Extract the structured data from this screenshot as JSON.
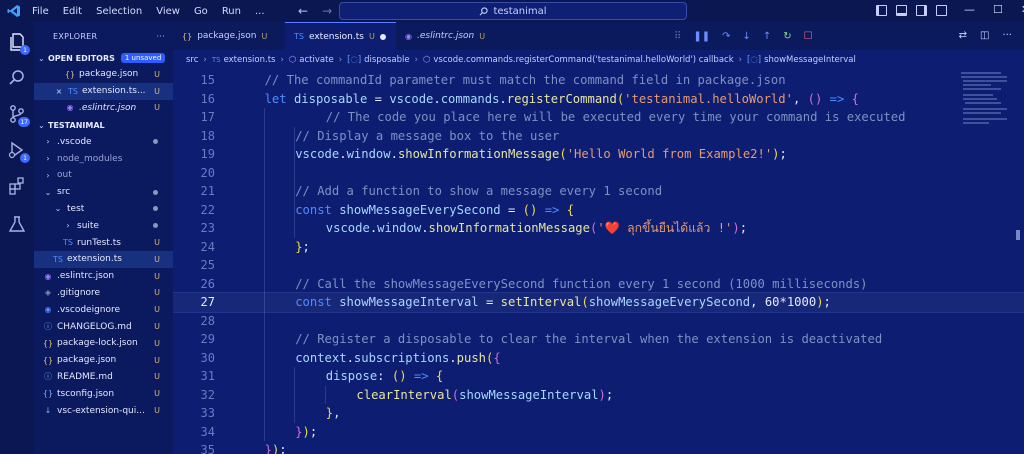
{
  "menu": [
    "File",
    "Edit",
    "Selection",
    "View",
    "Go",
    "Run"
  ],
  "more_menu": "...",
  "search": {
    "text": "testanimal"
  },
  "window_controls": {
    "minimize": "—",
    "maximize": "☐",
    "close": "✕"
  },
  "activity": {
    "explorer_badge": "1",
    "scm_badge": "17",
    "debug_badge": "1"
  },
  "sidebar": {
    "title": "EXPLORER",
    "more": "···",
    "open_editors": {
      "label": "OPEN EDITORS",
      "badge": "1 unsaved",
      "items": [
        {
          "name": "package.json",
          "status": "U",
          "icon": "{}",
          "icon_color": "#e5c07b"
        },
        {
          "name": "extension.ts...",
          "status": "U",
          "icon": "TS",
          "icon_color": "#4e8cff",
          "close": "×"
        },
        {
          "name": ".eslintrc.json",
          "status": "U",
          "icon": "◉",
          "icon_color": "#9d7cff"
        }
      ]
    },
    "project": {
      "label": "TESTANIMAL",
      "items": [
        {
          "name": ".vscode",
          "status": "",
          "icon": "›",
          "icon_color": "#c8ceff",
          "depth": 1,
          "dot": true
        },
        {
          "name": "node_modules",
          "status": "",
          "icon": "›",
          "icon_color": "#c8ceff",
          "depth": 1,
          "dot": false,
          "dim": true
        },
        {
          "name": "out",
          "status": "",
          "icon": "›",
          "icon_color": "#c8ceff",
          "depth": 1,
          "dot": false,
          "dim": true
        },
        {
          "name": "src",
          "status": "",
          "icon": "⌄",
          "icon_color": "#c8ceff",
          "depth": 1,
          "dot": true
        },
        {
          "name": "test",
          "status": "",
          "icon": "⌄",
          "icon_color": "#c8ceff",
          "depth": 2,
          "dot": true
        },
        {
          "name": "suite",
          "status": "",
          "icon": "›",
          "icon_color": "#c8ceff",
          "depth": 3,
          "dot": true
        },
        {
          "name": "runTest.ts",
          "status": "U",
          "icon": "TS",
          "icon_color": "#4e8cff",
          "depth": 3
        },
        {
          "name": "extension.ts",
          "status": "U",
          "icon": "TS",
          "icon_color": "#4e8cff",
          "depth": 2,
          "selected": true
        },
        {
          "name": ".eslintrc.json",
          "status": "U",
          "icon": "◉",
          "icon_color": "#9d7cff",
          "depth": 1
        },
        {
          "name": ".gitignore",
          "status": "U",
          "icon": "◈",
          "icon_color": "#8c96b8",
          "depth": 1
        },
        {
          "name": ".vscodeignore",
          "status": "U",
          "icon": "◉",
          "icon_color": "#4e8cff",
          "depth": 1
        },
        {
          "name": "CHANGELOG.md",
          "status": "U",
          "icon": "ⓘ",
          "icon_color": "#7fb0ff",
          "depth": 1
        },
        {
          "name": "package-lock.json",
          "status": "U",
          "icon": "{}",
          "icon_color": "#e5c07b",
          "depth": 1
        },
        {
          "name": "package.json",
          "status": "U",
          "icon": "{}",
          "icon_color": "#e5c07b",
          "depth": 1
        },
        {
          "name": "README.md",
          "status": "U",
          "icon": "ⓘ",
          "icon_color": "#7fb0ff",
          "depth": 1
        },
        {
          "name": "tsconfig.json",
          "status": "U",
          "icon": "{}",
          "icon_color": "#7fb0ff",
          "depth": 1
        },
        {
          "name": "vsc-extension-qui...",
          "status": "U",
          "icon": "↓",
          "icon_color": "#7fb0ff",
          "depth": 1
        }
      ]
    }
  },
  "tabs": [
    {
      "name": "package.json",
      "status": "U",
      "icon": "{}",
      "icon_color": "#e5c07b"
    },
    {
      "name": "extension.ts",
      "status": "U",
      "icon": "TS",
      "icon_color": "#4e8cff",
      "active": true,
      "dirty": true
    },
    {
      "name": ".eslintrc.json",
      "status": "U",
      "icon": "◉",
      "icon_color": "#9d7cff",
      "italic": true
    }
  ],
  "breadcrumb": [
    "src",
    "extension.ts",
    "activate",
    "disposable",
    "vscode.commands.registerCommand('testanimal.helloWorld') callback",
    "showMessageInterval"
  ],
  "editor": {
    "current_line": 27,
    "lines": [
      {
        "n": "15",
        "i": 1,
        "t": [
          [
            "c-cm",
            "// The commandId parameter must match the command field in package.json"
          ]
        ]
      },
      {
        "n": "16",
        "i": 1,
        "t": [
          [
            "c-kw",
            "let "
          ],
          [
            "c-var",
            "disposable"
          ],
          [
            "c-pun",
            " = "
          ],
          [
            "c-var",
            "vscode"
          ],
          [
            "c-pun",
            "."
          ],
          [
            "c-var",
            "commands"
          ],
          [
            "c-pun",
            "."
          ],
          [
            "c-fn",
            "registerCommand"
          ],
          [
            "c-br",
            "("
          ],
          [
            "c-str",
            "'testanimal.helloWorld'"
          ],
          [
            "c-pun",
            ", "
          ],
          [
            "c-br2",
            "()"
          ],
          [
            "c-kw",
            " => "
          ],
          [
            "c-br2",
            "{"
          ]
        ]
      },
      {
        "n": "17",
        "i": 3,
        "t": [
          [
            "c-cm",
            "// The code you place here will be executed every time your command is executed"
          ]
        ]
      },
      {
        "n": "18",
        "i": 2,
        "t": [
          [
            "c-cm",
            "// Display a message box to the user"
          ]
        ]
      },
      {
        "n": "19",
        "i": 2,
        "t": [
          [
            "c-var",
            "vscode"
          ],
          [
            "c-pun",
            "."
          ],
          [
            "c-var",
            "window"
          ],
          [
            "c-pun",
            "."
          ],
          [
            "c-fn",
            "showInformationMessage"
          ],
          [
            "c-br",
            "("
          ],
          [
            "c-str",
            "'Hello World from Example2!'"
          ],
          [
            "c-br",
            ")"
          ],
          [
            "c-pun",
            ";"
          ]
        ]
      },
      {
        "n": "20",
        "i": 0,
        "t": []
      },
      {
        "n": "21",
        "i": 2,
        "t": [
          [
            "c-cm",
            "// Add a function to show a message every 1 second"
          ]
        ]
      },
      {
        "n": "22",
        "i": 2,
        "t": [
          [
            "c-kw",
            "const "
          ],
          [
            "c-var",
            "showMessageEverySecond"
          ],
          [
            "c-pun",
            " = "
          ],
          [
            "c-br",
            "()"
          ],
          [
            "c-kw",
            " => "
          ],
          [
            "c-br",
            "{"
          ]
        ]
      },
      {
        "n": "23",
        "i": 3,
        "t": [
          [
            "c-var",
            "vscode"
          ],
          [
            "c-pun",
            "."
          ],
          [
            "c-var",
            "window"
          ],
          [
            "c-pun",
            "."
          ],
          [
            "c-fn",
            "showInformationMessage"
          ],
          [
            "c-br2",
            "("
          ],
          [
            "c-str",
            "'❤️ ลุกขึ้นยืนได้แล้ว !'"
          ],
          [
            "c-br2",
            ")"
          ],
          [
            "c-pun",
            ";"
          ]
        ]
      },
      {
        "n": "24",
        "i": 2,
        "t": [
          [
            "c-br",
            "}"
          ],
          [
            "c-pun",
            ";"
          ]
        ]
      },
      {
        "n": "25",
        "i": 0,
        "t": []
      },
      {
        "n": "26",
        "i": 2,
        "t": [
          [
            "c-cm",
            "// Call the showMessageEverySecond function every 1 second (1000 milliseconds)"
          ]
        ]
      },
      {
        "n": "27",
        "i": 2,
        "t": [
          [
            "c-kw",
            "const "
          ],
          [
            "c-var",
            "showMessageInterval"
          ],
          [
            "c-pun",
            " = "
          ],
          [
            "c-fn",
            "setInterval"
          ],
          [
            "c-br",
            "("
          ],
          [
            "c-var",
            "showMessageEverySecond"
          ],
          [
            "c-pun",
            ", 60*1000"
          ],
          [
            "c-br",
            ")"
          ],
          [
            "c-pun",
            ";"
          ]
        ]
      },
      {
        "n": "28",
        "i": 0,
        "t": []
      },
      {
        "n": "29",
        "i": 2,
        "t": [
          [
            "c-cm",
            "// Register a disposable to clear the interval when the extension is deactivated"
          ]
        ]
      },
      {
        "n": "30",
        "i": 2,
        "t": [
          [
            "c-var",
            "context"
          ],
          [
            "c-pun",
            "."
          ],
          [
            "c-var",
            "subscriptions"
          ],
          [
            "c-pun",
            "."
          ],
          [
            "c-fn",
            "push"
          ],
          [
            "c-br",
            "("
          ],
          [
            "c-br2",
            "{"
          ]
        ]
      },
      {
        "n": "31",
        "i": 3,
        "t": [
          [
            "c-var",
            "dispose"
          ],
          [
            "c-pun",
            ": "
          ],
          [
            "c-br",
            "()"
          ],
          [
            "c-kw",
            " => "
          ],
          [
            "c-br",
            "{"
          ]
        ]
      },
      {
        "n": "32",
        "i": 4,
        "t": [
          [
            "c-fn",
            "clearInterval"
          ],
          [
            "c-br2",
            "("
          ],
          [
            "c-var",
            "showMessageInterval"
          ],
          [
            "c-br2",
            ")"
          ],
          [
            "c-pun",
            ";"
          ]
        ]
      },
      {
        "n": "33",
        "i": 3,
        "t": [
          [
            "c-br",
            "}"
          ],
          [
            "c-pun",
            ","
          ]
        ]
      },
      {
        "n": "34",
        "i": 2,
        "t": [
          [
            "c-br2",
            "}"
          ],
          [
            "c-br",
            ")"
          ],
          [
            "c-pun",
            ";"
          ]
        ]
      },
      {
        "n": "35",
        "i": 1,
        "t": [
          [
            "c-br2",
            "}"
          ],
          [
            "c-br",
            ")"
          ],
          [
            "c-pun",
            ";"
          ]
        ]
      }
    ]
  }
}
